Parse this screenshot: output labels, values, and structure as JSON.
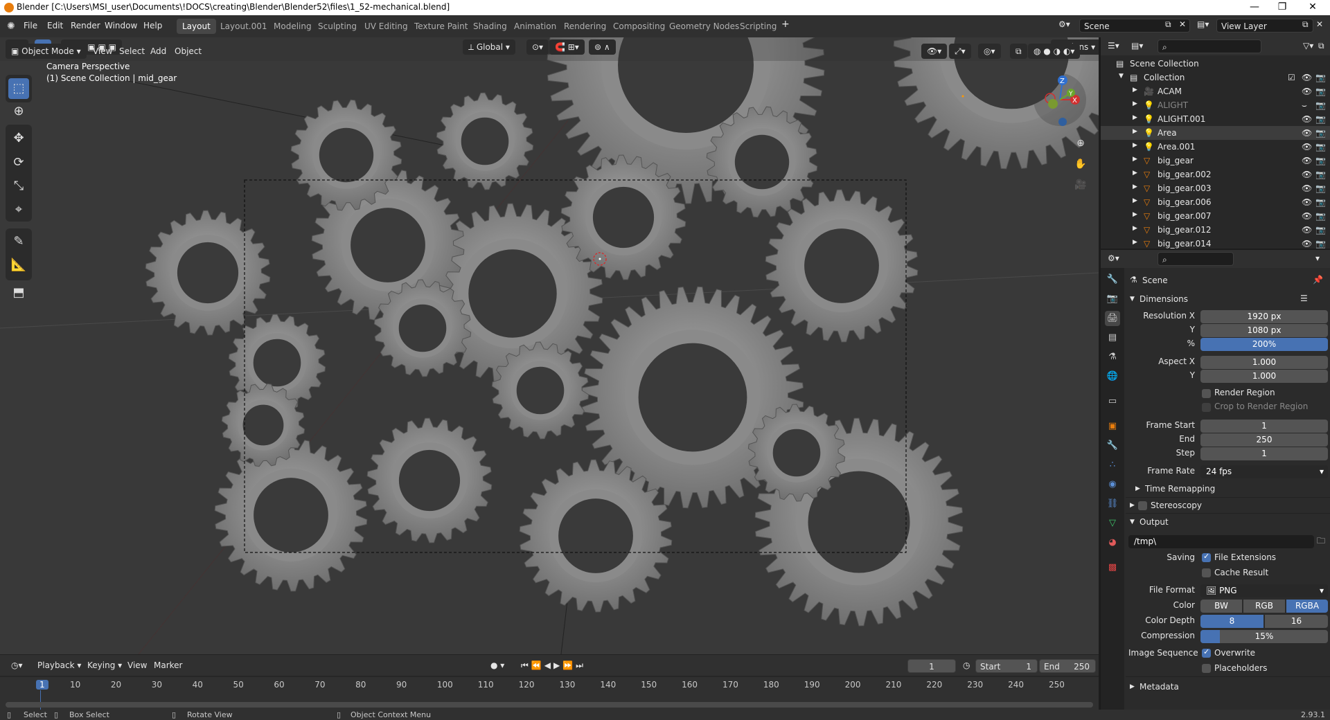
{
  "window": {
    "title": "Blender [C:\\Users\\MSI_user\\Documents\\!DOCS\\creating\\Blender\\Blender52\\files\\1_52-mechanical.blend]",
    "controls": [
      "—",
      "❐",
      "✕"
    ]
  },
  "menu": {
    "items": [
      "File",
      "Edit",
      "Render",
      "Window",
      "Help"
    ]
  },
  "workspaces": [
    "Layout",
    "Layout.001",
    "Modeling",
    "Sculpting",
    "UV Editing",
    "Texture Paint",
    "Shading",
    "Animation",
    "Rendering",
    "Compositing",
    "Geometry Nodes",
    "Scripting"
  ],
  "active_workspace": "Layout",
  "scene_field": "Scene",
  "viewlayer_field": "View Layer",
  "viewport": {
    "orientation": "Global",
    "options_label": "Options",
    "mode": "Object Mode",
    "header_menus": [
      "View",
      "Select",
      "Add",
      "Object"
    ],
    "overlay_line1": "Camera Perspective",
    "overlay_line2": "(1) Scene Collection | mid_gear",
    "gizmo": {
      "z": "Z",
      "y": "Y",
      "x": "X"
    }
  },
  "timeline": {
    "menus": [
      "Playback",
      "Keying",
      "View",
      "Marker"
    ],
    "current_frame": "1",
    "start_label": "Start",
    "start": "1",
    "end_label": "End",
    "end": "250",
    "ticks": [
      "1",
      "10",
      "20",
      "30",
      "40",
      "50",
      "60",
      "70",
      "80",
      "90",
      "100",
      "110",
      "120",
      "130",
      "140",
      "150",
      "160",
      "170",
      "180",
      "190",
      "200",
      "210",
      "220",
      "230",
      "240",
      "250"
    ]
  },
  "status": {
    "select": "Select",
    "box_select": "Box Select",
    "rotate": "Rotate View",
    "context_menu": "Object Context Menu",
    "version": "2.93.1"
  },
  "outliner": {
    "scene_collection": "Scene Collection",
    "collection": "Collection",
    "items": [
      {
        "name": "ACAM",
        "kind": "camera",
        "dim": false,
        "sel": false
      },
      {
        "name": "ALIGHT",
        "kind": "light",
        "dim": true,
        "sel": false
      },
      {
        "name": "ALIGHT.001",
        "kind": "light",
        "dim": false,
        "sel": false
      },
      {
        "name": "Area",
        "kind": "light",
        "dim": false,
        "sel": true
      },
      {
        "name": "Area.001",
        "kind": "light",
        "dim": false,
        "sel": false
      },
      {
        "name": "big_gear",
        "kind": "mesh",
        "dim": false,
        "sel": false
      },
      {
        "name": "big_gear.002",
        "kind": "mesh",
        "dim": false,
        "sel": false
      },
      {
        "name": "big_gear.003",
        "kind": "mesh",
        "dim": false,
        "sel": false
      },
      {
        "name": "big_gear.006",
        "kind": "mesh",
        "dim": false,
        "sel": false
      },
      {
        "name": "big_gear.007",
        "kind": "mesh",
        "dim": false,
        "sel": false
      },
      {
        "name": "big_gear.012",
        "kind": "mesh",
        "dim": false,
        "sel": false
      },
      {
        "name": "big_gear.014",
        "kind": "mesh",
        "dim": false,
        "sel": false
      }
    ]
  },
  "properties": {
    "context": "Scene",
    "dimensions": {
      "title": "Dimensions",
      "res_x_label": "Resolution X",
      "res_x": "1920 px",
      "res_y_label": "Y",
      "res_y": "1080 px",
      "pct_label": "%",
      "pct": "200%",
      "aspect_x_label": "Aspect X",
      "aspect_x": "1.000",
      "aspect_y_label": "Y",
      "aspect_y": "1.000",
      "render_region": "Render Region",
      "crop": "Crop to Render Region",
      "frame_start_label": "Frame Start",
      "frame_start": "1",
      "end_label": "End",
      "end": "250",
      "step_label": "Step",
      "step": "1",
      "frame_rate_label": "Frame Rate",
      "frame_rate": "24 fps",
      "time_remapping": "Time Remapping"
    },
    "stereoscopy": "Stereoscopy",
    "output": {
      "title": "Output",
      "path": "/tmp\\",
      "saving_label": "Saving",
      "file_extensions": "File Extensions",
      "cache_result": "Cache Result",
      "file_format_label": "File Format",
      "file_format": "PNG",
      "color_label": "Color",
      "color_opts": [
        "BW",
        "RGB",
        "RGBA"
      ],
      "color_active": "RGBA",
      "depth_label": "Color Depth",
      "depth_opts": [
        "8",
        "16"
      ],
      "depth_active": "8",
      "compression_label": "Compression",
      "compression": "15%",
      "compression_value": 0.15,
      "image_seq_label": "Image Sequence",
      "overwrite": "Overwrite",
      "placeholders": "Placeholders"
    },
    "metadata": "Metadata"
  }
}
